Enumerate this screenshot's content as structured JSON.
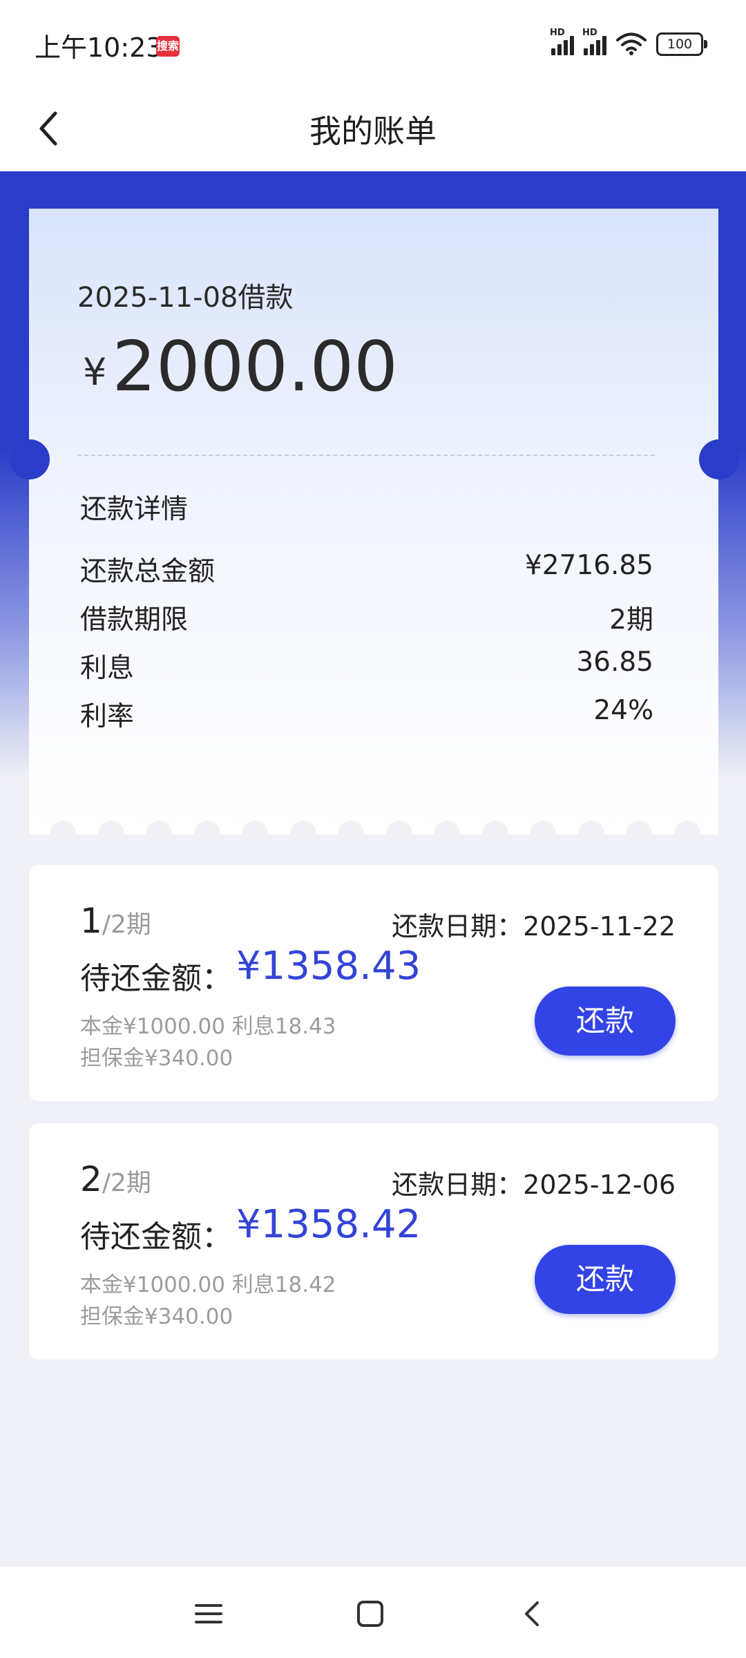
{
  "status_bar": {
    "time": "上午10:23",
    "notification_text": "搜索",
    "network_label_1": "HD",
    "network_label_2": "HD",
    "battery": "100"
  },
  "header": {
    "title": "我的账单"
  },
  "loan": {
    "date_label": "2025-11-08借款",
    "currency_symbol": "¥",
    "amount": "2000.00"
  },
  "details": {
    "title": "还款详情",
    "rows": [
      {
        "label": "还款总金额",
        "value": "¥2716.85"
      },
      {
        "label": "借款期限",
        "value": "2期"
      },
      {
        "label": "利息",
        "value": "36.85"
      },
      {
        "label": "利率",
        "value": "24%"
      }
    ]
  },
  "installments": [
    {
      "number": "1",
      "total_text": "/2期",
      "due_date": "还款日期：2025-11-22",
      "pending_label": "待还金额：",
      "pending_value": "¥1358.43",
      "principal_interest": "本金¥1000.00 利息18.43",
      "guarantee": "担保金¥340.00",
      "button_label": "还款"
    },
    {
      "number": "2",
      "total_text": "/2期",
      "due_date": "还款日期：2025-12-06",
      "pending_label": "待还金额：",
      "pending_value": "¥1358.42",
      "principal_interest": "本金¥1000.00 利息18.42",
      "guarantee": "担保金¥340.00",
      "button_label": "还款"
    }
  ],
  "nav_bar": {
    "items": [
      "menu-icon",
      "home-icon",
      "back-icon"
    ]
  },
  "colors": {
    "brand_blue": "#2a3cc8",
    "button_blue": "#3344e6",
    "amount_blue": "#3344d6",
    "page_bg": "#f0f1f6"
  }
}
